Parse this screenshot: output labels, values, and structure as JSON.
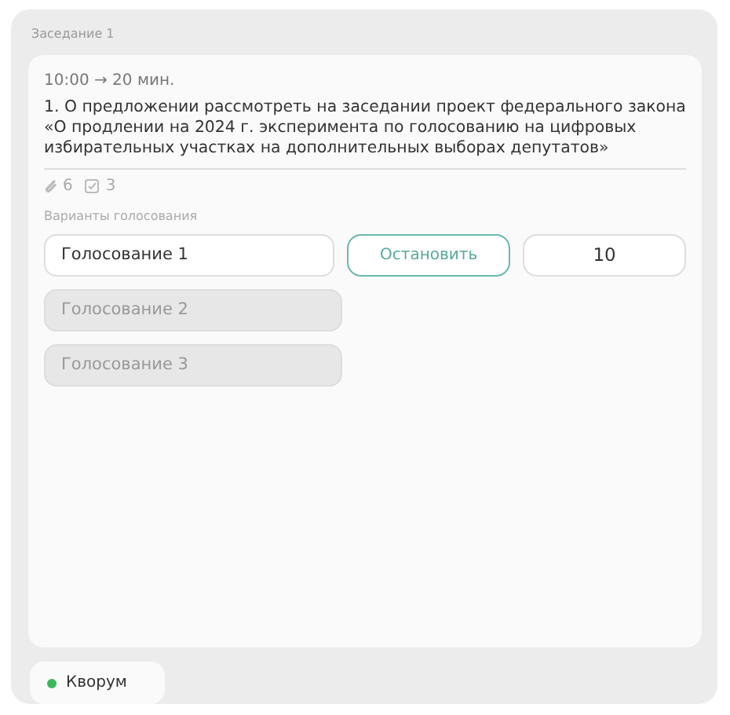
{
  "session": {
    "title": "Заседание 1"
  },
  "agenda_item": {
    "time": "10:00 → 20 мин.",
    "title": "1. О предложении рассмотреть на заседании проект федерального закона «О продлении на 2024 г. эксперимента по голосованию на цифровых избирательных участках на дополнительных выборах депутатов»",
    "attachments": "6",
    "tasks": "3"
  },
  "voting": {
    "label": "Варианты голосования",
    "options": [
      {
        "name": "Голосование 1",
        "active": true,
        "action": "Остановить",
        "count": "10"
      },
      {
        "name": "Голосование 2",
        "active": false
      },
      {
        "name": "Голосование 3",
        "active": false
      }
    ]
  },
  "quorum": {
    "label": "Кворум",
    "color": "#3cb85c"
  }
}
